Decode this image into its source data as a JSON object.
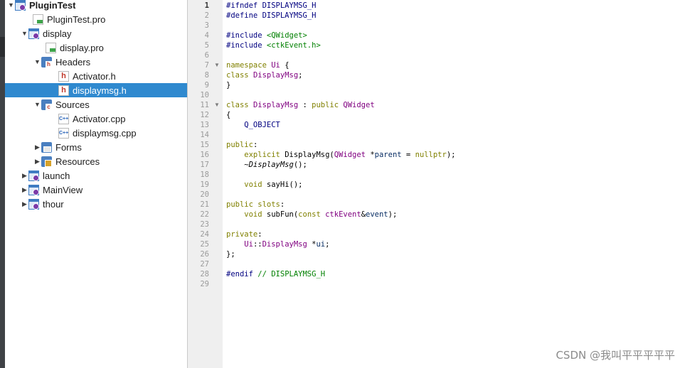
{
  "tree": {
    "items": [
      {
        "label": "PluginTest",
        "icon": "qt-project-icon",
        "arrow": "▼"
      },
      {
        "label": "PluginTest.pro",
        "icon": "pro-file-icon",
        "arrow": ""
      },
      {
        "label": "display",
        "icon": "qt-project-icon",
        "arrow": "▼"
      },
      {
        "label": "display.pro",
        "icon": "pro-file-icon",
        "arrow": ""
      },
      {
        "label": "Headers",
        "icon": "headers-folder-icon",
        "arrow": "▼"
      },
      {
        "label": "Activator.h",
        "icon": "header-file-icon",
        "arrow": ""
      },
      {
        "label": "displaymsg.h",
        "icon": "header-file-icon",
        "arrow": ""
      },
      {
        "label": "Sources",
        "icon": "sources-folder-icon",
        "arrow": "▼"
      },
      {
        "label": "Activator.cpp",
        "icon": "cpp-file-icon",
        "arrow": ""
      },
      {
        "label": "displaymsg.cpp",
        "icon": "cpp-file-icon",
        "arrow": ""
      },
      {
        "label": "Forms",
        "icon": "forms-folder-icon",
        "arrow": "▶"
      },
      {
        "label": "Resources",
        "icon": "resources-folder-icon",
        "arrow": "▶"
      },
      {
        "label": "launch",
        "icon": "qt-project-icon",
        "arrow": "▶"
      },
      {
        "label": "MainView",
        "icon": "qt-project-icon",
        "arrow": "▶"
      },
      {
        "label": "thour",
        "icon": "qt-project-icon",
        "arrow": "▶"
      }
    ]
  },
  "editor": {
    "line_numbers": [
      "1",
      "2",
      "3",
      "4",
      "5",
      "6",
      "7",
      "8",
      "9",
      "10",
      "11",
      "12",
      "13",
      "14",
      "15",
      "16",
      "17",
      "18",
      "19",
      "20",
      "21",
      "22",
      "23",
      "24",
      "25",
      "26",
      "27",
      "28",
      "29"
    ],
    "fold_markers": [
      "▼",
      "▼"
    ],
    "lines": [
      [
        {
          "t": "#ifndef DISPLAYMSG_H",
          "c": "#000080"
        }
      ],
      [
        {
          "t": "#define DISPLAYMSG_H",
          "c": "#000080"
        }
      ],
      [],
      [
        {
          "t": "#include ",
          "c": "#000080"
        },
        {
          "t": "<QWidget>",
          "c": "#008000"
        }
      ],
      [
        {
          "t": "#include ",
          "c": "#000080"
        },
        {
          "t": "<ctkEvent.h>",
          "c": "#008000"
        }
      ],
      [],
      [
        {
          "t": "namespace ",
          "c": "#808000"
        },
        {
          "t": "Ui",
          "c": "#800080"
        },
        {
          "t": " {",
          "c": "#000000"
        }
      ],
      [
        {
          "t": "class ",
          "c": "#808000"
        },
        {
          "t": "DisplayMsg",
          "c": "#800080"
        },
        {
          "t": ";",
          "c": "#000000"
        }
      ],
      [
        {
          "t": "}",
          "c": "#000000"
        }
      ],
      [],
      [
        {
          "t": "class ",
          "c": "#808000"
        },
        {
          "t": "DisplayMsg",
          "c": "#800080"
        },
        {
          "t": " : ",
          "c": "#000000"
        },
        {
          "t": "public ",
          "c": "#808000"
        },
        {
          "t": "QWidget",
          "c": "#800080"
        }
      ],
      [
        {
          "t": "{",
          "c": "#000000"
        }
      ],
      [
        {
          "t": "    Q_OBJECT",
          "c": "#000080"
        }
      ],
      [],
      [
        {
          "t": "public",
          "c": "#808000"
        },
        {
          "t": ":",
          "c": "#000000"
        }
      ],
      [
        {
          "t": "    explicit ",
          "c": "#808000"
        },
        {
          "t": "DisplayMsg(",
          "c": "#000000"
        },
        {
          "t": "QWidget",
          "c": "#800080"
        },
        {
          "t": " *",
          "c": "#000000"
        },
        {
          "t": "parent",
          "c": "#092e64"
        },
        {
          "t": " = ",
          "c": "#000000"
        },
        {
          "t": "nullptr",
          "c": "#808000"
        },
        {
          "t": ");",
          "c": "#000000"
        }
      ],
      [
        {
          "t": "    ~",
          "c": "#000000"
        },
        {
          "t": "DisplayMsg",
          "c": "#000000",
          "i": true
        },
        {
          "t": "();",
          "c": "#000000"
        }
      ],
      [],
      [
        {
          "t": "    void ",
          "c": "#808000"
        },
        {
          "t": "sayHi();",
          "c": "#000000"
        }
      ],
      [],
      [
        {
          "t": "public ",
          "c": "#808000"
        },
        {
          "t": "slots",
          "c": "#808000"
        },
        {
          "t": ":",
          "c": "#000000"
        }
      ],
      [
        {
          "t": "    void ",
          "c": "#808000"
        },
        {
          "t": "subFun(",
          "c": "#000000"
        },
        {
          "t": "const ",
          "c": "#808000"
        },
        {
          "t": "ctkEvent",
          "c": "#800080"
        },
        {
          "t": "&",
          "c": "#000000"
        },
        {
          "t": "event",
          "c": "#092e64"
        },
        {
          "t": ");",
          "c": "#000000"
        }
      ],
      [],
      [
        {
          "t": "private",
          "c": "#808000"
        },
        {
          "t": ":",
          "c": "#000000"
        }
      ],
      [
        {
          "t": "    Ui",
          "c": "#800080"
        },
        {
          "t": "::",
          "c": "#000000"
        },
        {
          "t": "DisplayMsg",
          "c": "#800080"
        },
        {
          "t": " *",
          "c": "#000000"
        },
        {
          "t": "ui",
          "c": "#092e64"
        },
        {
          "t": ";",
          "c": "#000000"
        }
      ],
      [
        {
          "t": "};",
          "c": "#000000"
        }
      ],
      [],
      [
        {
          "t": "#endif ",
          "c": "#000080"
        },
        {
          "t": "// DISPLAYMSG_H",
          "c": "#008000"
        }
      ],
      []
    ]
  },
  "watermark": "CSDN @我叫平平平平平"
}
